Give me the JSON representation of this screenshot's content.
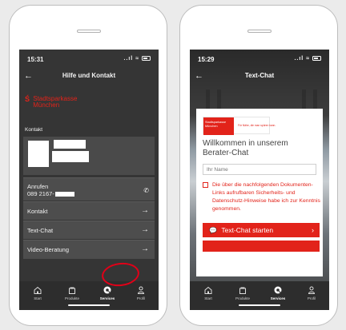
{
  "left": {
    "status": {
      "time": "15:31",
      "signal": "..ıl",
      "wifi": "≈"
    },
    "header": {
      "title": "Hilfe und Kontakt",
      "back": "←"
    },
    "brand": {
      "mark": "Ś",
      "line1": "Stadtsparkasse",
      "line2": "München"
    },
    "section_label": "Kontakt",
    "rows": [
      {
        "label": "Anrufen",
        "sublabel": "089 2167-",
        "icon": "phone-icon",
        "arrow": "✆"
      },
      {
        "label": "Kontakt",
        "arrow": "→"
      },
      {
        "label": "Text-Chat",
        "arrow": "→"
      },
      {
        "label": "Video-Beratung",
        "arrow": "→"
      }
    ],
    "tabs": [
      {
        "label": "Start",
        "icon": "home-icon"
      },
      {
        "label": "Produkte",
        "icon": "bag-icon"
      },
      {
        "label": "Services",
        "icon": "services-icon",
        "active": true
      },
      {
        "label": "Profil",
        "icon": "profile-icon"
      }
    ],
    "highlight_color": "#e10018"
  },
  "right": {
    "status": {
      "time": "15:29",
      "signal": "..ıl",
      "wifi": "≈"
    },
    "header": {
      "title": "Text-Chat",
      "back": "←"
    },
    "logo": {
      "line1": "Stadtsparkasse",
      "line2": "München",
      "tagline": "Für Nähe, die man spüren kann."
    },
    "welcome": "Willkommen in unserem Berater-Chat",
    "name_placeholder": "Ihr Name",
    "consent": "Die über die nachfolgenden Dokumenten-Links aufrufbaren Sicherheits- und Datenschutz-Hinweise habe ich zur Kenntnis genommen.",
    "start_button": "Text-Chat starten",
    "start_arrow": "›",
    "tabs": [
      {
        "label": "Start",
        "icon": "home-icon"
      },
      {
        "label": "Produkte",
        "icon": "bag-icon"
      },
      {
        "label": "Services",
        "icon": "services-icon",
        "active": true
      },
      {
        "label": "Profil",
        "icon": "profile-icon"
      }
    ]
  },
  "colors": {
    "brand_red": "#e2231a",
    "dark_bg": "#353535",
    "tabbar": "#2d2d2d"
  }
}
